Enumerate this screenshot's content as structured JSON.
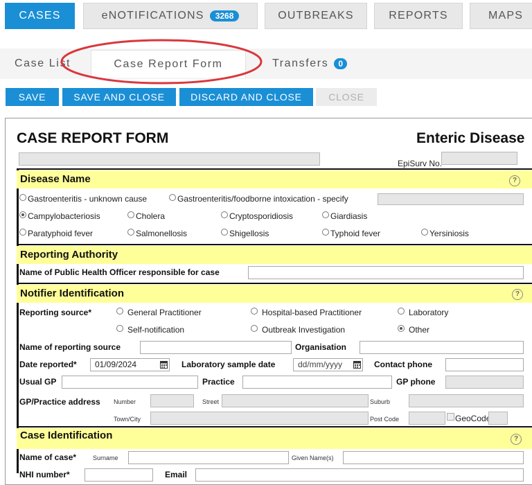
{
  "top_tabs": [
    {
      "label": "CASES"
    },
    {
      "label": "eNOTIFICATIONS",
      "badge": "3268"
    },
    {
      "label": "OUTBREAKS"
    },
    {
      "label": "REPORTS"
    },
    {
      "label": "MAPS"
    }
  ],
  "sub_tabs": [
    {
      "label": "Case List"
    },
    {
      "label": "Case Report Form"
    },
    {
      "label": "Transfers",
      "badge": "0"
    }
  ],
  "actions": {
    "save": "SAVE",
    "save_close": "SAVE AND CLOSE",
    "discard_close": "DISCARD AND CLOSE",
    "close": "CLOSE"
  },
  "form": {
    "title": "CASE REPORT FORM",
    "disease_type": "Enteric Disease",
    "episurv_label": "EpiSurv No.",
    "disease_name": {
      "heading": "Disease Name",
      "options": [
        "Gastroenteritis - unknown cause",
        "Gastroenteritis/foodborne intoxication - specify",
        "Campylobacteriosis",
        "Cholera",
        "Cryptosporidiosis",
        "Giardiasis",
        "Paratyphoid fever",
        "Salmonellosis",
        "Shigellosis",
        "Typhoid fever",
        "Yersiniosis"
      ],
      "selected": "Campylobacteriosis"
    },
    "reporting_authority": {
      "heading": "Reporting Authority",
      "officer_label": "Name of Public Health Officer responsible for case"
    },
    "notifier": {
      "heading": "Notifier Identification",
      "source_label": "Reporting source*",
      "source_options": [
        "General Practitioner",
        "Hospital-based Practitioner",
        "Laboratory",
        "Self-notification",
        "Outbreak Investigation",
        "Other"
      ],
      "selected": "Other",
      "name_source_label": "Name of reporting source",
      "organisation_label": "Organisation",
      "date_reported_label": "Date reported*",
      "date_reported_value": "01/09/2024",
      "lab_date_label": "Laboratory sample date",
      "lab_date_placeholder": "dd/mm/yyyy",
      "contact_phone_label": "Contact phone",
      "usual_gp_label": "Usual GP",
      "practice_label": "Practice",
      "gp_phone_label": "GP phone",
      "gp_address_label": "GP/Practice address",
      "number_label": "Number",
      "street_label": "Street",
      "suburb_label": "Suburb",
      "town_label": "Town/City",
      "postcode_label": "Post Code",
      "geocode_label": "GeoCode"
    },
    "case_id": {
      "heading": "Case Identification",
      "name_label": "Name of case*",
      "surname_label": "Surname",
      "given_label": "Given Name(s)",
      "nhi_label": "NHI number*",
      "email_label": "Email"
    }
  }
}
